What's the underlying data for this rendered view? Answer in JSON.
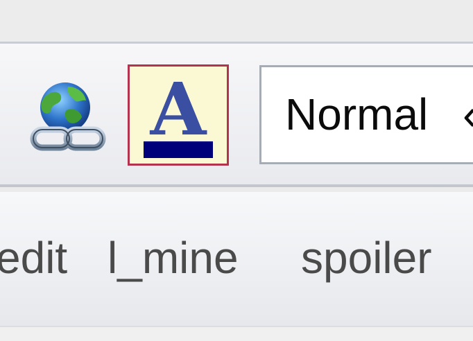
{
  "toolbar": {
    "link_button": {
      "icon": "globe-link-icon"
    },
    "font_color_button": {
      "icon": "font-color-icon",
      "glyph": "A",
      "color": "#00007a"
    },
    "format_select": {
      "value": "Normal",
      "arrow": "‹"
    }
  },
  "tag_bar": {
    "items": [
      {
        "label": "edit"
      },
      {
        "label": "l_mine"
      },
      {
        "label": "spoiler"
      }
    ]
  }
}
